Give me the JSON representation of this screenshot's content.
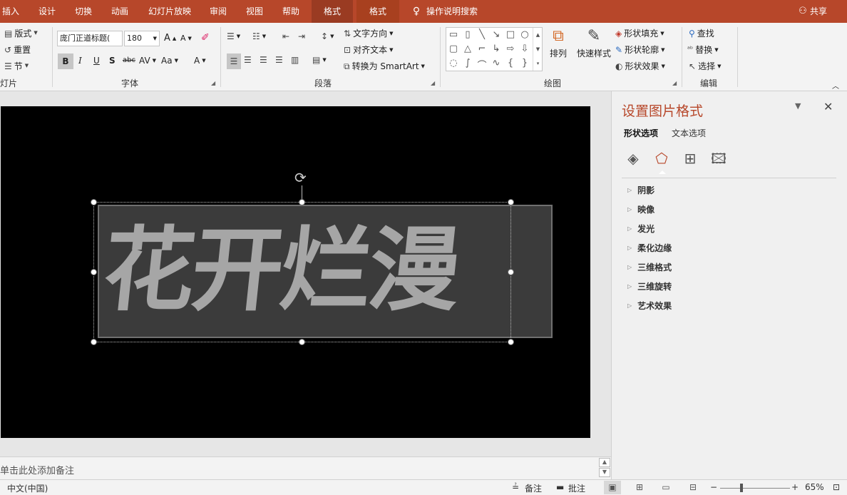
{
  "tabs": [
    {
      "label": "插入"
    },
    {
      "label": "设计"
    },
    {
      "label": "切换"
    },
    {
      "label": "动画"
    },
    {
      "label": "幻灯片放映"
    },
    {
      "label": "审阅"
    },
    {
      "label": "视图"
    },
    {
      "label": "帮助"
    },
    {
      "label": "格式"
    },
    {
      "label": "格式"
    }
  ],
  "tell_me": "操作说明搜索",
  "share": "共享",
  "ribbon": {
    "slides": {
      "layout": "版式",
      "reset": "重置",
      "section": "节",
      "group": "灯片"
    },
    "font": {
      "name": "庞门正道标题(",
      "size": "180",
      "bold": "B",
      "italic": "I",
      "underline": "U",
      "shadow": "S",
      "strike": "abc",
      "spacing": "AV",
      "case": "Aa",
      "color": "A",
      "grow": "A",
      "shrink": "A",
      "group": "字体"
    },
    "paragraph": {
      "text_direction": "文字方向",
      "align_text": "对齐文本",
      "smartart": "转换为 SmartArt",
      "group": "段落"
    },
    "drawing": {
      "arrange": "排列",
      "quick_styles": "快速样式",
      "fill": "形状填充",
      "outline": "形状轮廓",
      "effects": "形状效果",
      "group": "绘图"
    },
    "editing": {
      "find": "查找",
      "replace": "替换",
      "select": "选择",
      "group": "编辑"
    }
  },
  "slide": {
    "wordart": "花开烂漫",
    "bg_color": "#000000",
    "shape_color": "#3b3b3b",
    "text_color": "#a6a6a6"
  },
  "notes_placeholder": "单击此处添加备注",
  "pane": {
    "title": "设置图片格式",
    "tabs": [
      {
        "label": "形状选项"
      },
      {
        "label": "文本选项"
      }
    ],
    "sections": [
      {
        "label": "阴影"
      },
      {
        "label": "映像"
      },
      {
        "label": "发光"
      },
      {
        "label": "柔化边缘"
      },
      {
        "label": "三维格式"
      },
      {
        "label": "三维旋转"
      },
      {
        "label": "艺术效果"
      }
    ]
  },
  "status": {
    "language": "中文(中国)",
    "notes": "备注",
    "comments": "批注",
    "zoom": "65%",
    "zoom_level": 0.65
  },
  "accent": "#b7472a"
}
